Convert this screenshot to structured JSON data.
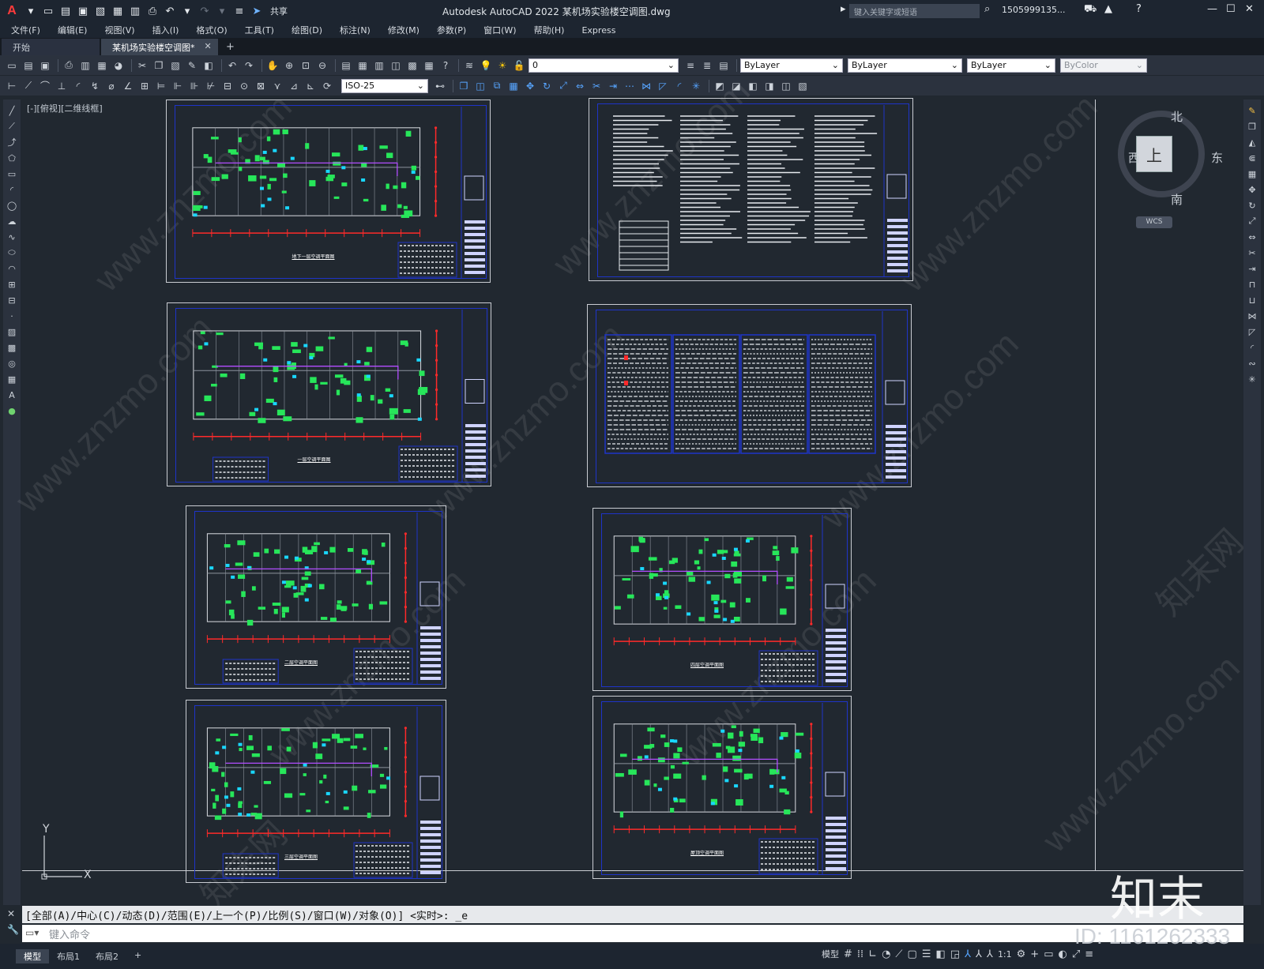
{
  "titlebar": {
    "logo": "A",
    "share": "共享",
    "title": "Autodesk AutoCAD 2022    某机场实验楼空调图.dwg",
    "search_placeholder": "键入关键字或短语",
    "user": "1505999135...",
    "minimize": "—",
    "maximize": "☐",
    "close": "✕"
  },
  "menu": [
    "文件(F)",
    "编辑(E)",
    "视图(V)",
    "插入(I)",
    "格式(O)",
    "工具(T)",
    "绘图(D)",
    "标注(N)",
    "修改(M)",
    "参数(P)",
    "窗口(W)",
    "帮助(H)",
    "Express"
  ],
  "tabs": {
    "start": "开始",
    "active": "某机场实验楼空调图*",
    "close": "✕",
    "add": "+"
  },
  "toolbar": {
    "layer": "0",
    "color": "ByLayer",
    "linetype": "ByLayer",
    "lineweight": "ByLayer",
    "plotstyle": "ByColor",
    "dimstyle": "ISO-25"
  },
  "viewport": {
    "label": "[-][俯视][二维线框]",
    "compass": {
      "north": "北",
      "south": "南",
      "east": "东",
      "west": "西",
      "top": "上",
      "wcs": "WCS"
    },
    "ucs_x": "X",
    "ucs_y": "Y"
  },
  "command": {
    "history": "[全部(A)/中心(C)/动态(D)/范围(E)/上一个(P)/比例(S)/窗口(W)/对象(O)] <实时>: _e",
    "placeholder": "键入命令"
  },
  "layouts": [
    "模型",
    "布局1",
    "布局2"
  ],
  "status": {
    "model": "模型",
    "scale": "1:1"
  },
  "overlay": {
    "brand": "知末",
    "id": "ID: 1161262333",
    "site": "www.znzmo.com",
    "cn": "知末网"
  },
  "sheets": [
    {
      "title": "地下一层空调平面图"
    },
    {
      "title": ""
    },
    {
      "title": "一层空调平面图"
    },
    {
      "title": ""
    },
    {
      "title": "二层空调平面图"
    },
    {
      "title": "四层空调平面图"
    },
    {
      "title": "三层空调平面图"
    },
    {
      "title": "屋顶空调平面图"
    }
  ]
}
